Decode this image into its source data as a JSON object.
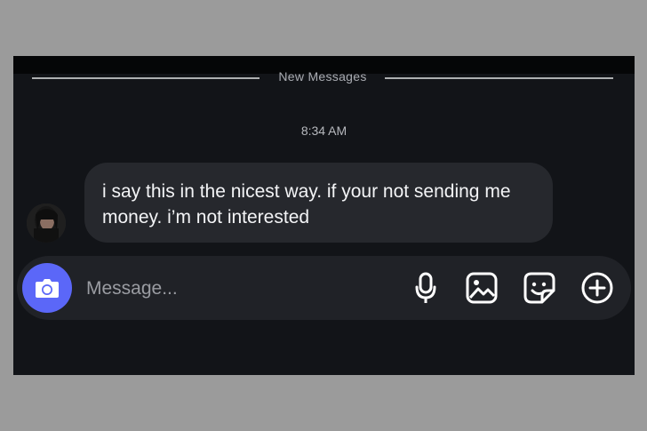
{
  "divider": {
    "label": "New Messages"
  },
  "timestamp": "8:34 AM",
  "message": {
    "text": "i say this in the nicest way. if your not sending me money. i’m not interested"
  },
  "composer": {
    "placeholder": "Message..."
  },
  "icons": {
    "camera": "camera-icon",
    "microphone": "microphone-icon",
    "gallery": "gallery-icon",
    "sticker": "sticker-icon",
    "add": "plus-icon"
  },
  "colors": {
    "camera_button": "#5b67f8",
    "bubble": "#26282d",
    "background": "#121418"
  }
}
